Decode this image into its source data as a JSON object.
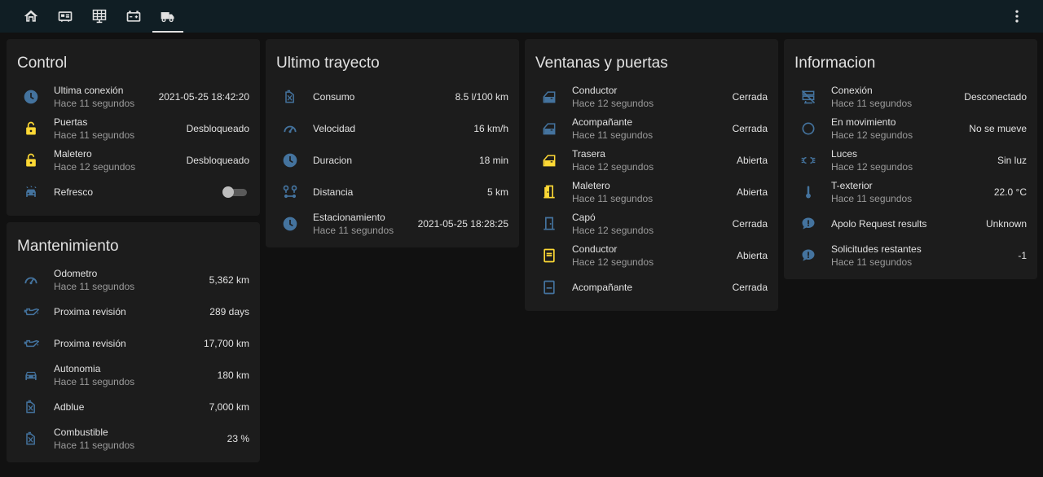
{
  "colors": {
    "icon_blue": "#44739e",
    "icon_yellow": "#fdd835",
    "background": "#111111",
    "card": "#1c1c1c",
    "header": "#101e24"
  },
  "tabs": [
    {
      "icon": "home-icon"
    },
    {
      "icon": "fuel-pump-icon"
    },
    {
      "icon": "solar-panel-icon"
    },
    {
      "icon": "battery-icon"
    },
    {
      "icon": "truck-icon",
      "active": true
    }
  ],
  "control": {
    "title": "Control",
    "rows": [
      {
        "name": "Ultima conexión",
        "secondary": "Hace 11 segundos",
        "value": "2021-05-25 18:42:20",
        "icon": "clock-icon"
      },
      {
        "name": "Puertas",
        "secondary": "Hace 11 segundos",
        "value": "Desbloqueado",
        "icon": "lock-open-icon"
      },
      {
        "name": "Maletero",
        "secondary": "Hace 12 segundos",
        "value": "Desbloqueado",
        "icon": "lock-open-icon"
      },
      {
        "name": "Refresco",
        "toggle": "off",
        "icon": "car-wash-icon"
      }
    ]
  },
  "mantenimiento": {
    "title": "Mantenimiento",
    "rows": [
      {
        "name": "Odometro",
        "secondary": "Hace 11 segundos",
        "value": "5,362 km",
        "icon": "speedometer-icon"
      },
      {
        "name": "Proxima revisión",
        "value": "289 days",
        "icon": "oil-can-icon"
      },
      {
        "name": "Proxima revisión",
        "value": "17,700 km",
        "icon": "oil-can-icon"
      },
      {
        "name": "Autonomia",
        "secondary": "Hace 11 segundos",
        "value": "180 km",
        "icon": "car-icon"
      },
      {
        "name": "Adblue",
        "value": "7,000 km",
        "icon": "fuel-can-icon"
      },
      {
        "name": "Combustible",
        "secondary": "Hace 11 segundos",
        "value": "23 %",
        "icon": "fuel-can-icon"
      }
    ]
  },
  "trayecto": {
    "title": "Ultimo trayecto",
    "rows": [
      {
        "name": "Consumo",
        "value": "8.5 l/100 km",
        "icon": "fuel-can-icon"
      },
      {
        "name": "Velocidad",
        "value": "16 km/h",
        "icon": "speedometer-icon"
      },
      {
        "name": "Duracion",
        "value": "18 min",
        "icon": "clock-icon"
      },
      {
        "name": "Distancia",
        "value": "5 km",
        "icon": "map-marker-distance-icon"
      },
      {
        "name": "Estacionamiento",
        "secondary": "Hace 11 segundos",
        "value": "2021-05-25 18:28:25",
        "icon": "clock-icon"
      }
    ]
  },
  "ventanas": {
    "title": "Ventanas y puertas",
    "rows": [
      {
        "name": "Conductor",
        "secondary": "Hace 12 segundos",
        "value": "Cerrada",
        "icon": "car-door-icon"
      },
      {
        "name": "Acompañante",
        "secondary": "Hace 11 segundos",
        "value": "Cerrada",
        "icon": "car-door-icon"
      },
      {
        "name": "Trasera",
        "secondary": "Hace 12 segundos",
        "value": "Abierta",
        "icon": "car-door-open-icon"
      },
      {
        "name": "Maletero",
        "secondary": "Hace 11 segundos",
        "value": "Abierta",
        "icon": "door-open-icon"
      },
      {
        "name": "Capó",
        "secondary": "Hace 12 segundos",
        "value": "Cerrada",
        "icon": "door-closed-icon"
      },
      {
        "name": "Conductor",
        "secondary": "Hace 12 segundos",
        "value": "Abierta",
        "icon": "window-open-icon"
      },
      {
        "name": "Acompañante",
        "value": "Cerrada",
        "icon": "window-closed-icon"
      }
    ]
  },
  "informacion": {
    "title": "Informacion",
    "rows": [
      {
        "name": "Conexión",
        "secondary": "Hace 11 segundos",
        "value": "Desconectado",
        "icon": "server-off-icon"
      },
      {
        "name": "En movimiento",
        "secondary": "Hace 12 segundos",
        "value": "No se mueve",
        "icon": "circle-outline-icon"
      },
      {
        "name": "Luces",
        "secondary": "Hace 12 segundos",
        "value": "Sin luz",
        "icon": "car-light-icon"
      },
      {
        "name": "T-exterior",
        "secondary": "Hace 11 segundos",
        "value": "22.0 °C",
        "icon": "thermometer-icon"
      },
      {
        "name": "Apolo Request results",
        "value": "Unknown",
        "icon": "message-alert-icon"
      },
      {
        "name": "Solicitudes restantes",
        "secondary": "Hace 11 segundos",
        "value": "-1",
        "icon": "message-alert-icon"
      }
    ]
  }
}
